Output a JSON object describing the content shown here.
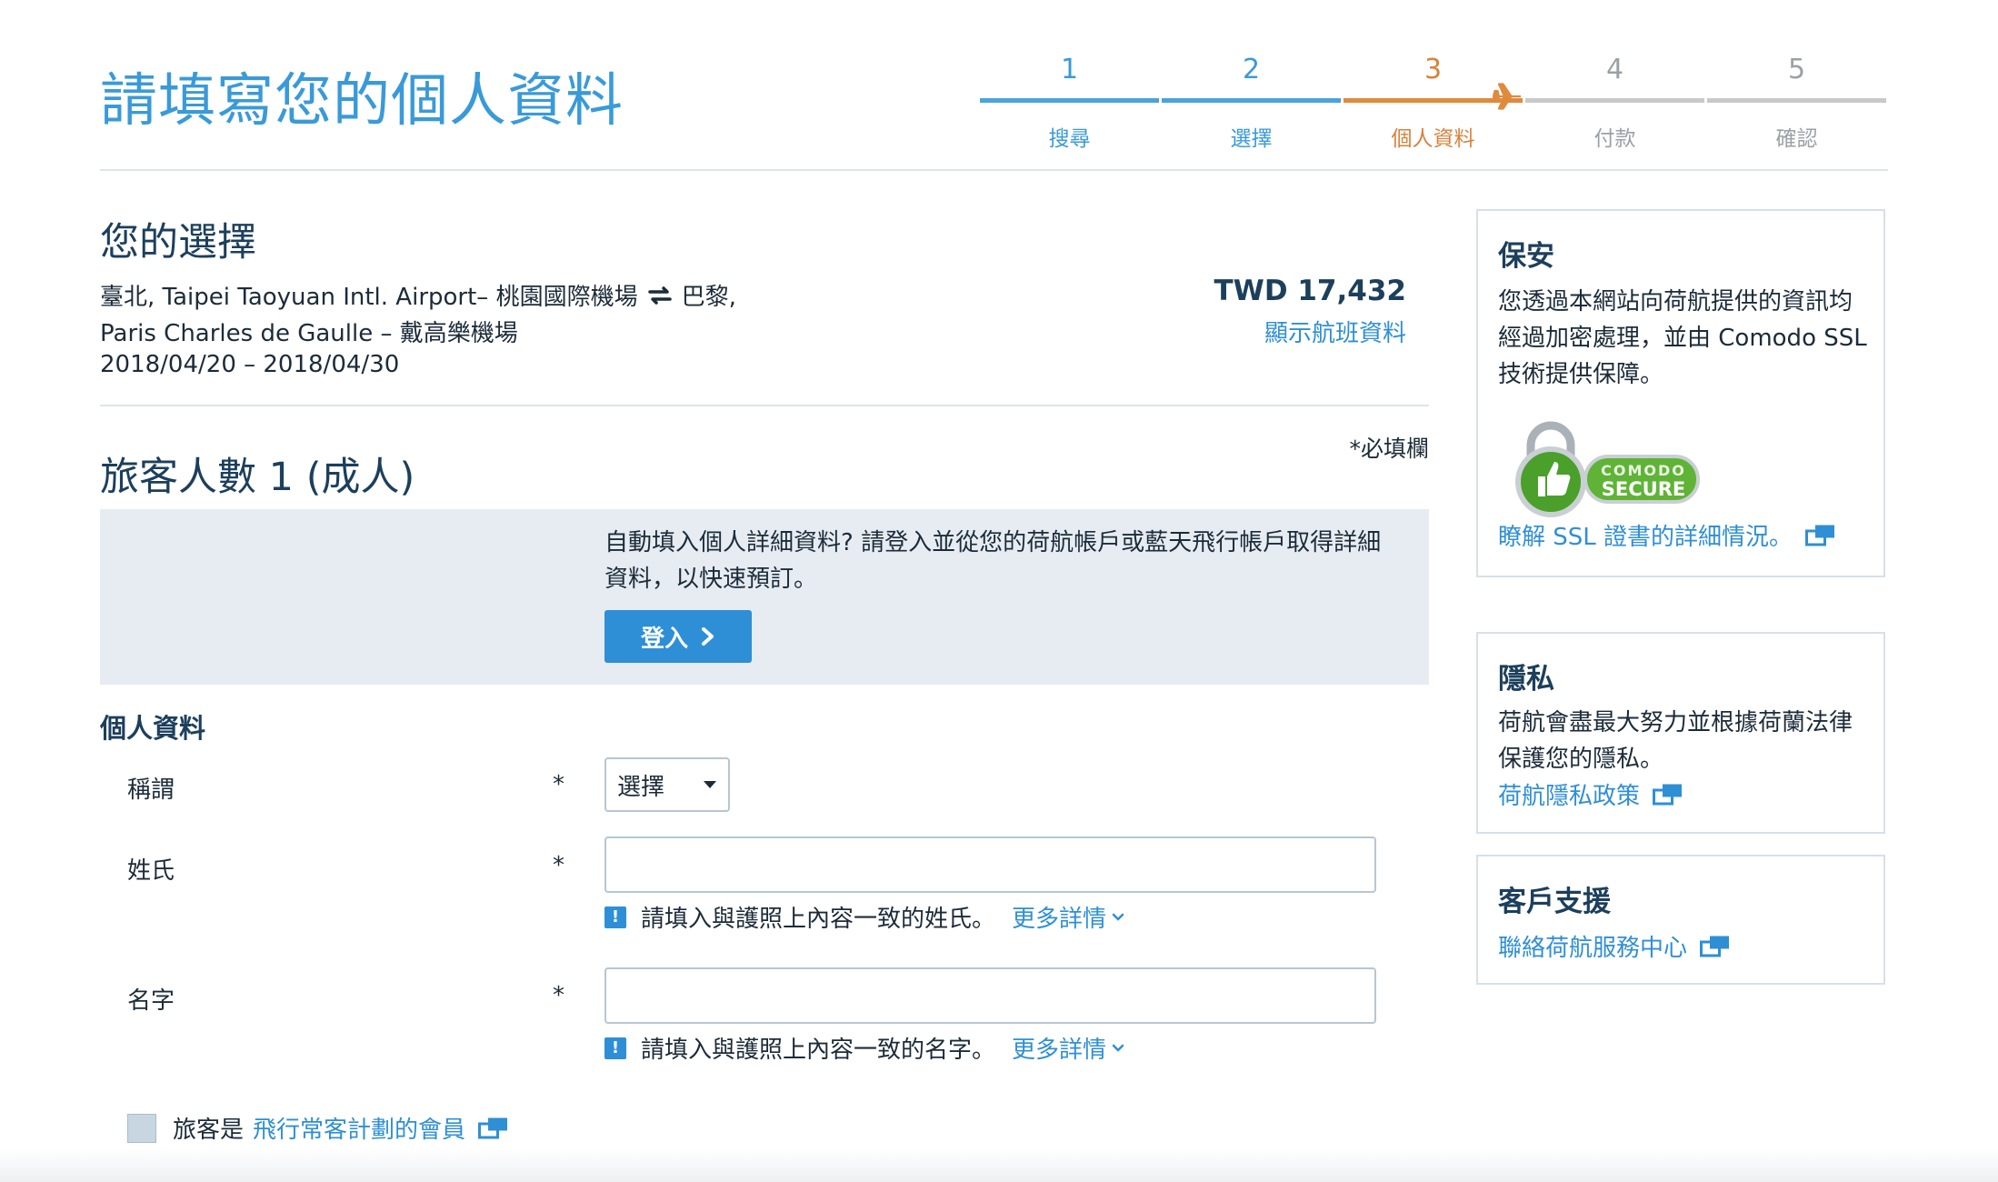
{
  "header": {
    "title": "請填寫您的個人資料",
    "steps": [
      {
        "num": "1",
        "label": "搜尋"
      },
      {
        "num": "2",
        "label": "選擇"
      },
      {
        "num": "3",
        "label": "個人資料"
      },
      {
        "num": "4",
        "label": "付款"
      },
      {
        "num": "5",
        "label": "確認"
      }
    ]
  },
  "selection": {
    "title": "您的選擇",
    "route_line1a": "臺北, Taipei Taoyuan Intl. Airport– 桃園國際機場",
    "route_line1b": "巴黎,",
    "route_line2": "Paris Charles de Gaulle – 戴高樂機場",
    "dates": "2018/04/20 – 2018/04/30",
    "price": "TWD 17,432",
    "show_flight": "顯示航班資料"
  },
  "passengers": {
    "title": "旅客人數 1 (成人)",
    "required_note": "*必填欄",
    "login_text": "自動填入個人詳細資料? 請登入並從您的荷航帳戶或藍天飛行帳戶取得詳細資料，以快速預訂。",
    "login_button": "登入"
  },
  "personal": {
    "title": "個人資料",
    "star": "*",
    "salutation_label": "稱謂",
    "salutation_value": "選擇",
    "surname_label": "姓氏",
    "surname_value": "",
    "surname_hint": "請填入與護照上內容一致的姓氏。",
    "given_label": "名字",
    "given_value": "",
    "given_hint": "請填入與護照上內容一致的名字。",
    "more_details": "更多詳情",
    "member_prefix": "旅客是",
    "member_link": "飛行常客計劃的會員"
  },
  "sidebar": {
    "security_title": "保安",
    "security_text": "您透過本網站向荷航提供的資訊均經過加密處理，並由 Comodo SSL 技術提供保障。",
    "comodo_top": "COMODO",
    "comodo_bottom": "SECURE",
    "ssl_link": "瞭解 SSL 證書的詳細情況。",
    "privacy_title": "隱私",
    "privacy_text": "荷航會盡最大努力並根據荷蘭法律保護您的隱私。",
    "privacy_link": "荷航隱私政策",
    "support_title": "客戶支援",
    "support_link": "聯絡荷航服務中心"
  },
  "colors": {
    "accent": "#2f8fd4",
    "current_step": "#e08a3c",
    "title_blue": "#3a9ad8"
  }
}
